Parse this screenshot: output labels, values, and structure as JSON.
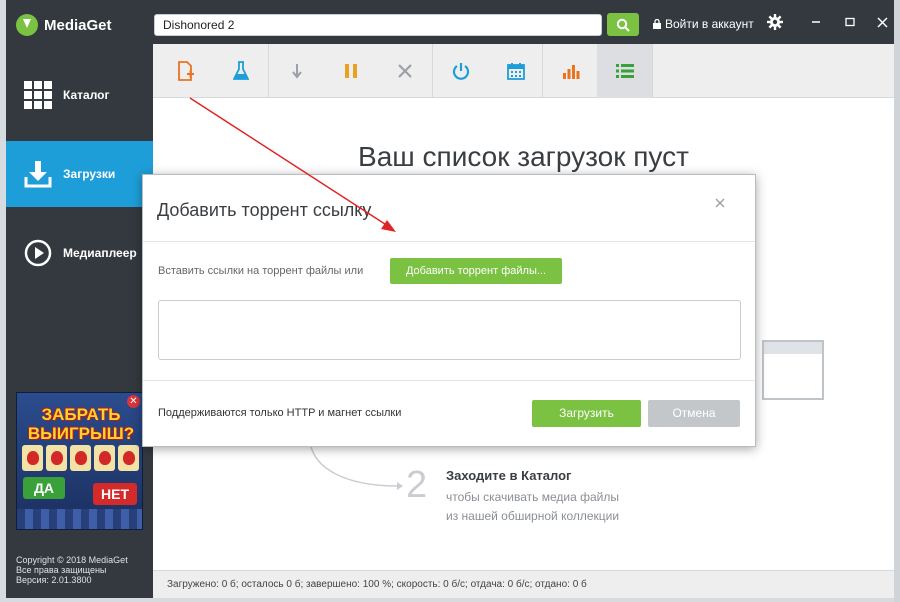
{
  "app": {
    "name": "MediaGet",
    "login_label": "Войти в аккаунт"
  },
  "search": {
    "value": "Dishonored 2"
  },
  "sidebar": {
    "items": [
      {
        "label": "Каталог",
        "icon": "grid-icon",
        "active": false
      },
      {
        "label": "Загрузки",
        "icon": "download-icon",
        "active": true
      },
      {
        "label": "Медиаплеер",
        "icon": "play-icon",
        "active": false
      }
    ],
    "ad": {
      "title": "ЗАБРАТЬ ВЫИГРЫШ?",
      "yes": "ДА",
      "no": "НЕТ"
    },
    "copyright": {
      "line1": "Copyright © 2018 MediaGet",
      "line2": "Все права защищены",
      "line3": "Версия: 2.01.3800"
    }
  },
  "toolbar": {
    "buttons": [
      "add-file-icon",
      "flask-icon",
      "download-arrow-icon",
      "pause-icon",
      "stop-icon",
      "power-icon",
      "calendar-icon",
      "chart-icon",
      "list-icon"
    ],
    "colors": {
      "orange": "#e9731f",
      "teal": "#1e9ed8",
      "gray": "#9aa0a6",
      "green": "#7bc142"
    }
  },
  "main": {
    "empty_title": "Ваш список загрузок пуст",
    "step2": {
      "number": "2",
      "title": "Заходите в Каталог",
      "desc1": "чтобы скачивать медиа файлы",
      "desc2": "из нашей обширной коллекции"
    }
  },
  "dialog": {
    "title": "Добавить торрент ссылку",
    "paste_label": "Вставить ссылки на торрент файлы или",
    "add_files_button": "Добавить торрент файлы...",
    "textarea_value": "",
    "support_note": "Поддерживаются только HTTP и магнет ссылки",
    "upload_button": "Загрузить",
    "cancel_button": "Отмена"
  },
  "statusbar": {
    "text": "Загружено: 0 б; осталось 0 б; завершено: 100 %; скорость: 0 б/с; отдача: 0 б/с; отдано: 0 б"
  },
  "colors": {
    "sidebar_bg": "#33393f",
    "accent_blue": "#1e9ed8",
    "accent_green": "#7bc142",
    "annotation_red": "#e02424"
  }
}
